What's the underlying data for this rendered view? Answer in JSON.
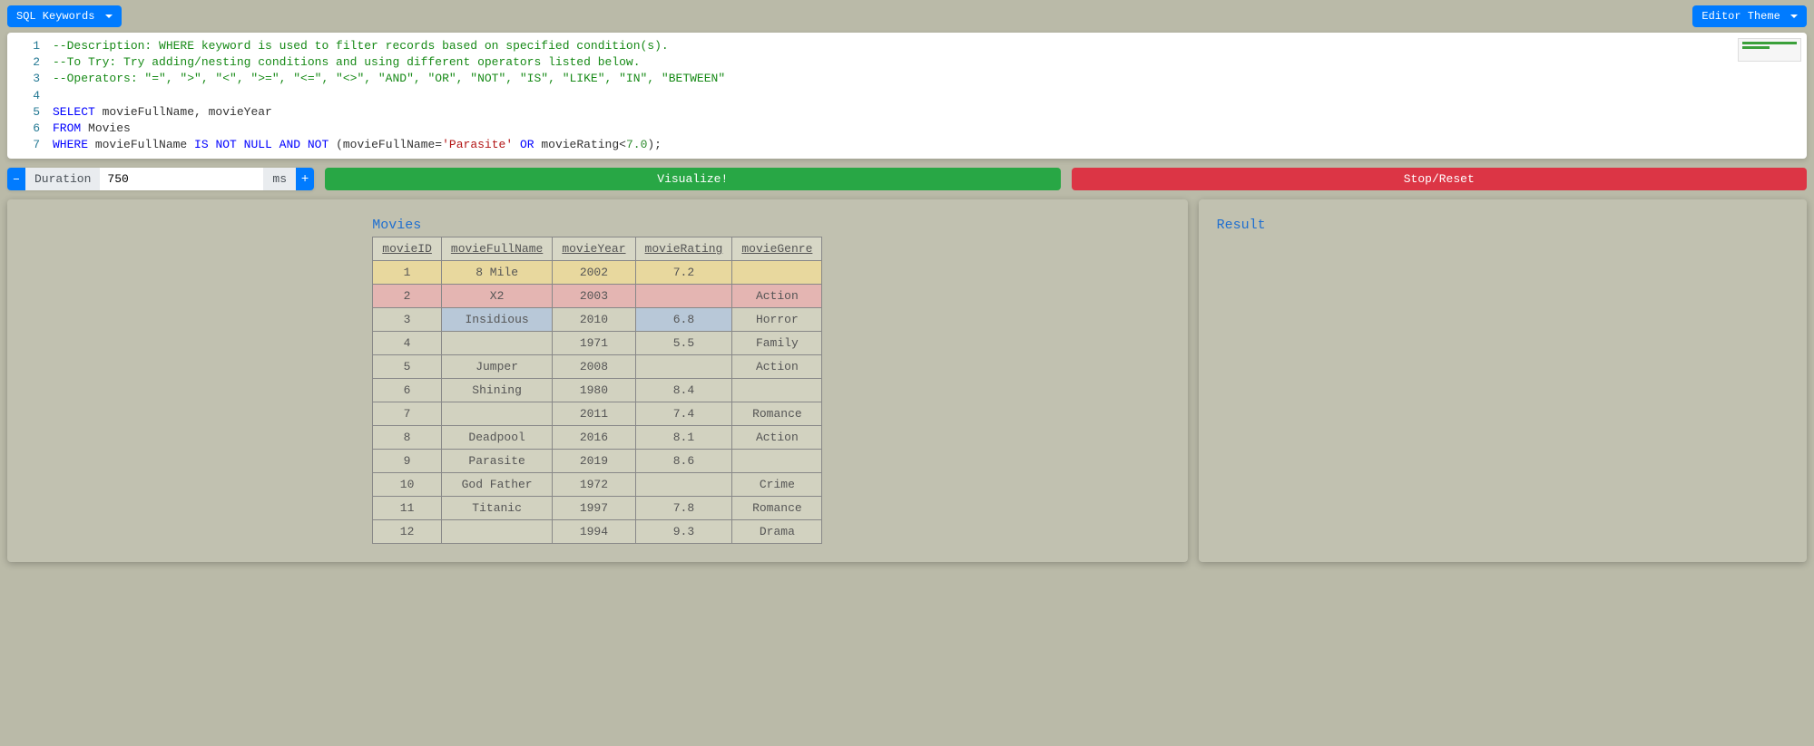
{
  "topbar": {
    "sql_keywords_label": "SQL Keywords",
    "editor_theme_label": "Editor Theme"
  },
  "editor": {
    "lines": [
      {
        "n": "1",
        "tokens": [
          {
            "cls": "tok-comment",
            "t": "--Description: WHERE keyword is used to filter records based on specified condition(s)."
          }
        ]
      },
      {
        "n": "2",
        "tokens": [
          {
            "cls": "tok-comment",
            "t": "--To Try: Try adding/nesting conditions and using different operators listed below."
          }
        ]
      },
      {
        "n": "3",
        "tokens": [
          {
            "cls": "tok-comment",
            "t": "--Operators: \"=\", \">\", \"<\", \">=\", \"<=\", \"<>\", \"AND\", \"OR\", \"NOT\", \"IS\", \"LIKE\", \"IN\", \"BETWEEN\""
          }
        ]
      },
      {
        "n": "4",
        "tokens": [
          {
            "cls": "tok-plain",
            "t": ""
          }
        ]
      },
      {
        "n": "5",
        "tokens": [
          {
            "cls": "tok-keyword",
            "t": "SELECT"
          },
          {
            "cls": "tok-plain",
            "t": " movieFullName, movieYear"
          }
        ]
      },
      {
        "n": "6",
        "tokens": [
          {
            "cls": "tok-keyword",
            "t": "FROM"
          },
          {
            "cls": "tok-plain",
            "t": " Movies"
          }
        ]
      },
      {
        "n": "7",
        "tokens": [
          {
            "cls": "tok-keyword",
            "t": "WHERE"
          },
          {
            "cls": "tok-plain",
            "t": " movieFullName "
          },
          {
            "cls": "tok-keyword",
            "t": "IS NOT NULL AND NOT"
          },
          {
            "cls": "tok-plain",
            "t": " (movieFullName="
          },
          {
            "cls": "tok-string",
            "t": "'Parasite'"
          },
          {
            "cls": "tok-plain",
            "t": " "
          },
          {
            "cls": "tok-keyword",
            "t": "OR"
          },
          {
            "cls": "tok-plain",
            "t": " movieRating<"
          },
          {
            "cls": "tok-number",
            "t": "7.0"
          },
          {
            "cls": "tok-plain",
            "t": ");"
          }
        ]
      }
    ]
  },
  "controls": {
    "minus": "–",
    "plus": "+",
    "duration_label": "Duration",
    "duration_value": "750",
    "ms_label": "ms",
    "visualize_label": "Visualize!",
    "stop_label": "Stop/Reset"
  },
  "leftPanel": {
    "title": "Movies",
    "columns": [
      "movieID",
      "movieFullName",
      "movieYear",
      "movieRating",
      "movieGenre"
    ],
    "rows": [
      {
        "hl": "yellow",
        "cells": [
          "1",
          "8 Mile",
          "2002",
          "7.2",
          ""
        ]
      },
      {
        "hl": "red",
        "cells": [
          "2",
          "X2",
          "2003",
          "",
          "Action"
        ]
      },
      {
        "hl": "",
        "cells": [
          "3",
          "Insidious",
          "2010",
          "6.8",
          "Horror"
        ],
        "blueCols": [
          1,
          3
        ]
      },
      {
        "hl": "",
        "cells": [
          "4",
          "",
          "1971",
          "5.5",
          "Family"
        ]
      },
      {
        "hl": "",
        "cells": [
          "5",
          "Jumper",
          "2008",
          "",
          "Action"
        ]
      },
      {
        "hl": "",
        "cells": [
          "6",
          "Shining",
          "1980",
          "8.4",
          ""
        ]
      },
      {
        "hl": "",
        "cells": [
          "7",
          "",
          "2011",
          "7.4",
          "Romance"
        ]
      },
      {
        "hl": "",
        "cells": [
          "8",
          "Deadpool",
          "2016",
          "8.1",
          "Action"
        ]
      },
      {
        "hl": "",
        "cells": [
          "9",
          "Parasite",
          "2019",
          "8.6",
          ""
        ]
      },
      {
        "hl": "",
        "cells": [
          "10",
          "God Father",
          "1972",
          "",
          "Crime"
        ]
      },
      {
        "hl": "",
        "cells": [
          "11",
          "Titanic",
          "1997",
          "7.8",
          "Romance"
        ]
      },
      {
        "hl": "",
        "cells": [
          "12",
          "",
          "1994",
          "9.3",
          "Drama"
        ]
      }
    ]
  },
  "rightPanel": {
    "title": "Result"
  }
}
